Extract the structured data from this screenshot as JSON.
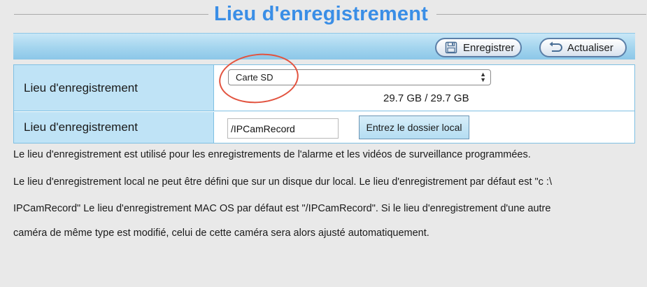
{
  "page": {
    "title": "Lieu d'enregistrement",
    "accent_color": "#3a8ee6"
  },
  "toolbar": {
    "save_label": "Enregistrer",
    "save_icon": "floppy-disk-icon",
    "refresh_label": "Actualiser",
    "refresh_icon": "refresh-arrow-icon"
  },
  "form": {
    "rows": [
      {
        "label": "Lieu d'enregistrement",
        "select_value": "Carte SD",
        "storage": "29.7 GB / 29.7 GB",
        "highlight_color": "#e2533f"
      },
      {
        "label": "Lieu d'enregistrement",
        "path_value": "/IPCamRecord",
        "button_label": "Entrez le dossier local"
      }
    ]
  },
  "description": {
    "line1": "Le lieu d'enregistrement est utilisé pour les enregistrements de l'alarme et les vidéos de surveillance programmées.",
    "line2": "Le lieu d'enregistrement local ne peut être défini que sur un disque dur local. Le lieu d'enregistrement par défaut est \"c :\\",
    "line3": "IPCamRecord\" Le lieu d'enregistrement MAC OS par défaut est \"/IPCamRecord\". Si le lieu d'enregistrement d'une autre",
    "line4": "caméra de même type est modifié, celui de cette caméra sera alors ajusté automatiquement."
  }
}
